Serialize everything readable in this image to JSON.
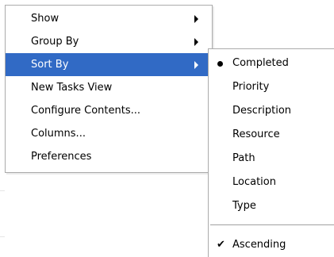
{
  "main_menu": {
    "items": [
      {
        "label": "Show",
        "has_submenu": true
      },
      {
        "label": "Group By",
        "has_submenu": true
      },
      {
        "label": "Sort By",
        "has_submenu": true,
        "highlighted": true
      },
      {
        "label": "New Tasks View",
        "has_submenu": false
      },
      {
        "label": "Configure Contents...",
        "has_submenu": false
      },
      {
        "label": "Columns...",
        "has_submenu": false
      },
      {
        "label": "Preferences",
        "has_submenu": false
      }
    ],
    "highlight_color": "#316ac5"
  },
  "sort_submenu": {
    "items": [
      {
        "label": "Completed",
        "selected": true
      },
      {
        "label": "Priority"
      },
      {
        "label": "Description"
      },
      {
        "label": "Resource"
      },
      {
        "label": "Path"
      },
      {
        "label": "Location"
      },
      {
        "label": "Type"
      }
    ],
    "ascending": {
      "label": "Ascending",
      "checked": true,
      "icon": "checkmark-icon"
    },
    "selected_icon": "bullet-icon"
  }
}
